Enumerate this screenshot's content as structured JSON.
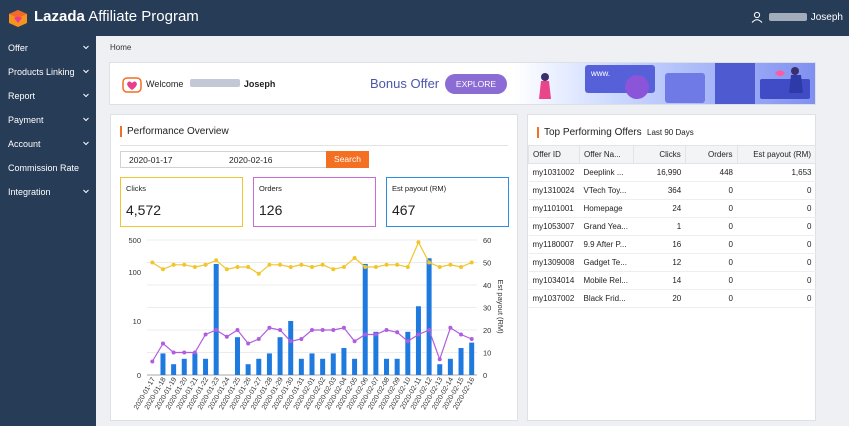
{
  "app": {
    "brand_bold": "Lazada",
    "brand_rest": " Affiliate Program",
    "user_name": "Joseph"
  },
  "sidebar": {
    "items": [
      {
        "label": "Offer",
        "has_arrow": true
      },
      {
        "label": "Products Linking",
        "has_arrow": true
      },
      {
        "label": "Report",
        "has_arrow": true
      },
      {
        "label": "Payment",
        "has_arrow": true
      },
      {
        "label": "Account",
        "has_arrow": true
      },
      {
        "label": "Commission Rate",
        "has_arrow": false
      },
      {
        "label": "Integration",
        "has_arrow": true
      }
    ]
  },
  "breadcrumb": "Home",
  "banner": {
    "welcome_label": "Welcome",
    "welcome_name": "Joseph",
    "bonus_text": "Bonus Offer",
    "explore_label": "EXPLORE",
    "art_text": "www."
  },
  "performance": {
    "title": "Performance Overview",
    "date_from": "2020-01-17",
    "date_to": "2020-02-16",
    "search_label": "Search",
    "kpis": [
      {
        "label": "Clicks",
        "value": "4,572",
        "color": "#f0c531"
      },
      {
        "label": "Orders",
        "value": "126",
        "color": "#c96ad7"
      },
      {
        "label": "Est payout (RM)",
        "value": "467",
        "color": "#2b8ee0"
      }
    ]
  },
  "chart_data": {
    "type": "bar",
    "categories": [
      "2020-01-17",
      "2020-01-18",
      "2020-01-19",
      "2020-01-20",
      "2020-01-21",
      "2020-01-22",
      "2020-01-23",
      "2020-01-24",
      "2020-01-25",
      "2020-01-26",
      "2020-01-27",
      "2020-01-28",
      "2020-01-29",
      "2020-01-30",
      "2020-01-31",
      "2020-02-01",
      "2020-02-02",
      "2020-02-03",
      "2020-02-04",
      "2020-02-05",
      "2020-02-06",
      "2020-02-07",
      "2020-02-08",
      "2020-02-09",
      "2020-02-10",
      "2020-02-11",
      "2020-02-12",
      "2020-02-13",
      "2020-02-14",
      "2020-02-15",
      "2020-02-16"
    ],
    "bars": [
      0,
      4,
      2,
      3,
      4,
      3,
      150,
      0,
      7,
      2,
      3,
      4,
      7,
      10,
      3,
      4,
      3,
      4,
      5,
      3,
      150,
      8,
      3,
      3,
      8,
      20,
      200,
      2,
      3,
      5,
      6
    ],
    "line_payout": [
      50,
      47,
      49,
      49,
      48,
      49,
      51,
      47,
      48,
      48,
      45,
      49,
      49,
      48,
      49,
      48,
      49,
      47,
      48,
      52,
      48,
      48,
      49,
      49,
      48,
      59,
      50,
      48,
      49,
      48,
      50
    ],
    "line_orders": [
      6,
      14,
      10,
      10,
      10,
      18,
      20,
      17,
      20,
      14,
      16,
      21,
      20,
      15,
      16,
      20,
      20,
      20,
      21,
      15,
      18,
      18,
      20,
      19,
      15,
      18,
      20,
      7,
      21,
      18,
      16
    ],
    "y_left_ticks": [
      "0",
      "10",
      "100",
      "500"
    ],
    "y_right_ticks": [
      0,
      10,
      20,
      30,
      40,
      50,
      60
    ],
    "y_right_label": "Est payout (RM)",
    "colors": {
      "bars": "#1f7ae0",
      "payout": "#f1c62c",
      "orders": "#b05de0"
    }
  },
  "top_offers": {
    "title": "Top Performing Offers",
    "subtitle": "Last 90 Days",
    "columns": [
      "Offer ID",
      "Offer Na...",
      "Clicks",
      "Orders",
      "Est payout (RM)"
    ],
    "rows": [
      {
        "id": "my1031002",
        "name": "Deeplink ...",
        "clicks": "16,990",
        "orders": "448",
        "payout": "1,653"
      },
      {
        "id": "my1310024",
        "name": "VTech Toy...",
        "clicks": "364",
        "orders": "0",
        "payout": "0"
      },
      {
        "id": "my1101001",
        "name": "Homepage",
        "clicks": "24",
        "orders": "0",
        "payout": "0"
      },
      {
        "id": "my1053007",
        "name": "Grand Yea...",
        "clicks": "1",
        "orders": "0",
        "payout": "0"
      },
      {
        "id": "my1180007",
        "name": "9.9 After P...",
        "clicks": "16",
        "orders": "0",
        "payout": "0"
      },
      {
        "id": "my1309008",
        "name": "Gadget Te...",
        "clicks": "12",
        "orders": "0",
        "payout": "0"
      },
      {
        "id": "my1034014",
        "name": "Mobile Rel...",
        "clicks": "14",
        "orders": "0",
        "payout": "0"
      },
      {
        "id": "my1037002",
        "name": "Black Frid...",
        "clicks": "20",
        "orders": "0",
        "payout": "0"
      }
    ]
  }
}
